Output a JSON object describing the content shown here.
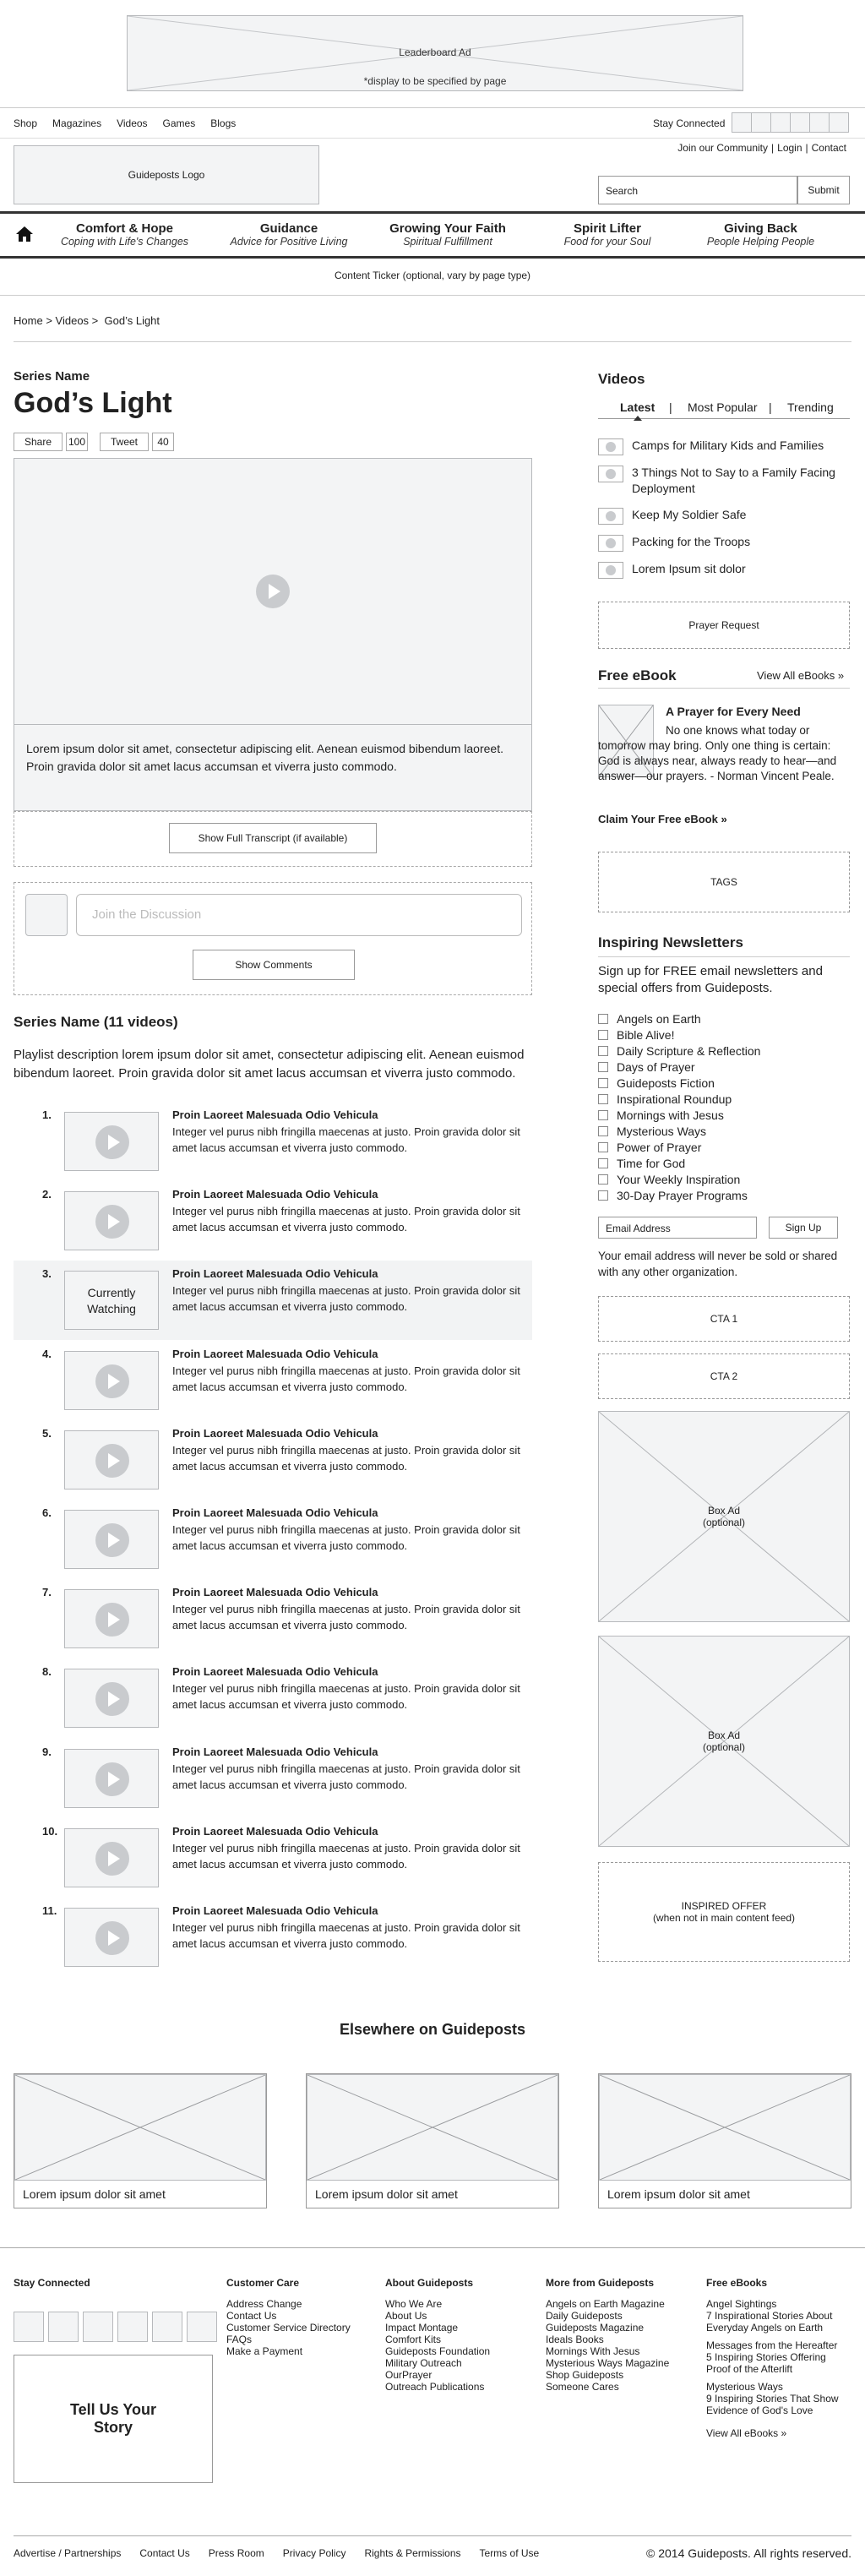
{
  "ad": {
    "title": "Leaderboard Ad",
    "note": "*display to be specified by page"
  },
  "util": {
    "links": [
      "Shop",
      "Magazines",
      "Videos",
      "Games",
      "Blogs"
    ],
    "stay": "Stay Connected"
  },
  "header": {
    "logo": "Guideposts Logo",
    "account": [
      "Join our Community",
      "Login",
      "Contact"
    ],
    "search_placeholder": "Search",
    "submit": "Submit"
  },
  "nav": [
    {
      "t": "Comfort & Hope",
      "s": "Coping with Life's Changes"
    },
    {
      "t": "Guidance",
      "s": "Advice for Positive Living"
    },
    {
      "t": "Growing Your Faith",
      "s": "Spiritual Fulfillment"
    },
    {
      "t": "Spirit Lifter",
      "s": "Food for your Soul"
    },
    {
      "t": "Giving Back",
      "s": "People Helping People"
    }
  ],
  "ticker": "Content Ticker (optional, vary by page type)",
  "breadcrumb": {
    "home": "Home",
    "videos": "Videos",
    "current": "God’s Light",
    "sep": ">"
  },
  "main": {
    "series": "Series Name",
    "title": "God’s Light",
    "share": {
      "label": "Share",
      "count": "100"
    },
    "tweet": {
      "label": "Tweet",
      "count": "40"
    },
    "caption": "Lorem ipsum dolor sit amet, consectetur adipiscing elit. Aenean euismod bibendum laoreet. Proin gravida dolor sit amet lacus accumsan et viverra justo commodo.",
    "transcript": "Show Full Transcript (if available)",
    "join": "Join the Discussion",
    "comments": "Show Comments",
    "playlist_title": "Series Name (11 videos)",
    "playlist_desc": "Playlist description lorem ipsum dolor sit amet, consectetur adipiscing elit. Aenean euismod bibendum laoreet. Proin gravida dolor sit amet lacus accumsan et viverra justo commodo.",
    "current_label": "Currently Watching",
    "videos": [
      {
        "n": "1.",
        "h": "Proin Laoreet Malesuada Odio Vehicula",
        "d": "Integer vel purus nibh fringilla maecenas at justo. Proin gravida dolor sit amet lacus accumsan et viverra justo commodo."
      },
      {
        "n": "2.",
        "h": "Proin Laoreet Malesuada Odio Vehicula",
        "d": "Integer vel purus nibh fringilla maecenas at justo. Proin gravida dolor sit amet lacus accumsan et viverra justo commodo."
      },
      {
        "n": "3.",
        "h": "Proin Laoreet Malesuada Odio Vehicula",
        "d": "Integer vel purus nibh fringilla maecenas at justo. Proin gravida dolor sit amet lacus accumsan et viverra justo commodo."
      },
      {
        "n": "4.",
        "h": "Proin Laoreet Malesuada Odio Vehicula",
        "d": "Integer vel purus nibh fringilla maecenas at justo. Proin gravida dolor sit amet lacus accumsan et viverra justo commodo."
      },
      {
        "n": "5.",
        "h": "Proin Laoreet Malesuada Odio Vehicula",
        "d": "Integer vel purus nibh fringilla maecenas at justo. Proin gravida dolor sit amet lacus accumsan et viverra justo commodo."
      },
      {
        "n": "6.",
        "h": "Proin Laoreet Malesuada Odio Vehicula",
        "d": "Integer vel purus nibh fringilla maecenas at justo. Proin gravida dolor sit amet lacus accumsan et viverra justo commodo."
      },
      {
        "n": "7.",
        "h": "Proin Laoreet Malesuada Odio Vehicula",
        "d": "Integer vel purus nibh fringilla maecenas at justo. Proin gravida dolor sit amet lacus accumsan et viverra justo commodo."
      },
      {
        "n": "8.",
        "h": "Proin Laoreet Malesuada Odio Vehicula",
        "d": "Integer vel purus nibh fringilla maecenas at justo. Proin gravida dolor sit amet lacus accumsan et viverra justo commodo."
      },
      {
        "n": "9.",
        "h": "Proin Laoreet Malesuada Odio Vehicula",
        "d": "Integer vel purus nibh fringilla maecenas at justo. Proin gravida dolor sit amet lacus accumsan et viverra justo commodo."
      },
      {
        "n": "10.",
        "h": "Proin Laoreet Malesuada Odio Vehicula",
        "d": "Integer vel purus nibh fringilla maecenas at justo. Proin gravida dolor sit amet lacus accumsan et viverra justo commodo."
      },
      {
        "n": "11.",
        "h": "Proin Laoreet Malesuada Odio Vehicula",
        "d": "Integer vel purus nibh fringilla maecenas at justo. Proin gravida dolor sit amet lacus accumsan et viverra justo commodo."
      }
    ]
  },
  "side": {
    "videos_title": "Videos",
    "tabs": [
      "Latest",
      "Most Popular",
      "Trending"
    ],
    "tab_sep": "|",
    "latest": [
      "Camps for Military Kids and Families",
      "3 Things Not to Say to a Family Facing Deployment",
      "Keep My Soldier Safe",
      "Packing for the Troops",
      "Lorem Ipsum sit dolor"
    ],
    "prayer": "Prayer Request",
    "ebook": {
      "head": "Free eBook",
      "all": "View All eBooks »",
      "title": "A Prayer for Every Need",
      "text": "No one knows what today or tomorrow may bring. Only one thing is certain: God is always near, always ready to hear—and answer—our prayers. - Norman Vincent Peale.",
      "claim": "Claim Your Free eBook »"
    },
    "tags": "TAGS",
    "nl": {
      "head": "Inspiring Newsletters",
      "intro": "Sign up for FREE email newsletters and special offers from Guideposts.",
      "items": [
        "Angels on Earth",
        "Bible Alive!",
        "Daily Scripture & Reflection",
        "Days of Prayer",
        "Guideposts Fiction",
        "Inspirational Roundup",
        "Mornings with Jesus",
        "Mysterious Ways",
        "Power of Prayer",
        "Time for God",
        "Your Weekly Inspiration",
        "30-Day Prayer Programs"
      ],
      "email": "Email Address",
      "signup": "Sign Up",
      "note": "Your email address will never be sold or shared with any other organization."
    },
    "cta1": "CTA 1",
    "cta2": "CTA 2",
    "boxad": "Box Ad",
    "boxad_opt": "(optional)",
    "offer": "INSPIRED OFFER",
    "offer_note": "(when not in main content feed)"
  },
  "elsewhere": {
    "title": "Elsewhere on Guideposts",
    "cards": [
      "Lorem ipsum dolor sit amet",
      "Lorem ipsum dolor sit amet",
      "Lorem ipsum dolor sit amet"
    ]
  },
  "footer": {
    "stay": "Stay Connected",
    "tell": "Tell Us Your Story",
    "cols": [
      {
        "h": "Customer Care",
        "items": [
          "Address Change",
          "Contact Us",
          "Customer Service Directory",
          "FAQs",
          "Make a Payment"
        ]
      },
      {
        "h": "About Guideposts",
        "items": [
          "Who We Are",
          "About Us",
          "Impact Montage",
          "Comfort Kits",
          "Guideposts Foundation",
          "Military Outreach",
          "OurPrayer",
          "Outreach Publications"
        ]
      },
      {
        "h": "More from Guideposts",
        "items": [
          "Angels on Earth Magazine",
          "Daily Guideposts",
          "Guideposts Magazine",
          "Ideals Books",
          "Mornings With Jesus",
          "Mysterious Ways Magazine",
          "Shop Guideposts",
          "Someone Cares"
        ]
      }
    ],
    "ebooks": {
      "h": "Free eBooks",
      "groups": [
        "Angel Sightings\n7 Inspirational Stories About Everyday Angels on Earth",
        "Messages from the Hereafter\n5 Inspiring Stories Offering Proof of the Afterlift",
        "Mysterious Ways\n9 Inspiring Stories That Show Evidence of God's Love"
      ],
      "all": "View All eBooks »"
    },
    "bottom": [
      "Advertise / Partnerships",
      "Contact Us",
      "Press Room",
      "Privacy Policy",
      "Rights & Permissions",
      "Terms of Use"
    ],
    "copy": "© 2014 Guideposts. All rights reserved."
  }
}
